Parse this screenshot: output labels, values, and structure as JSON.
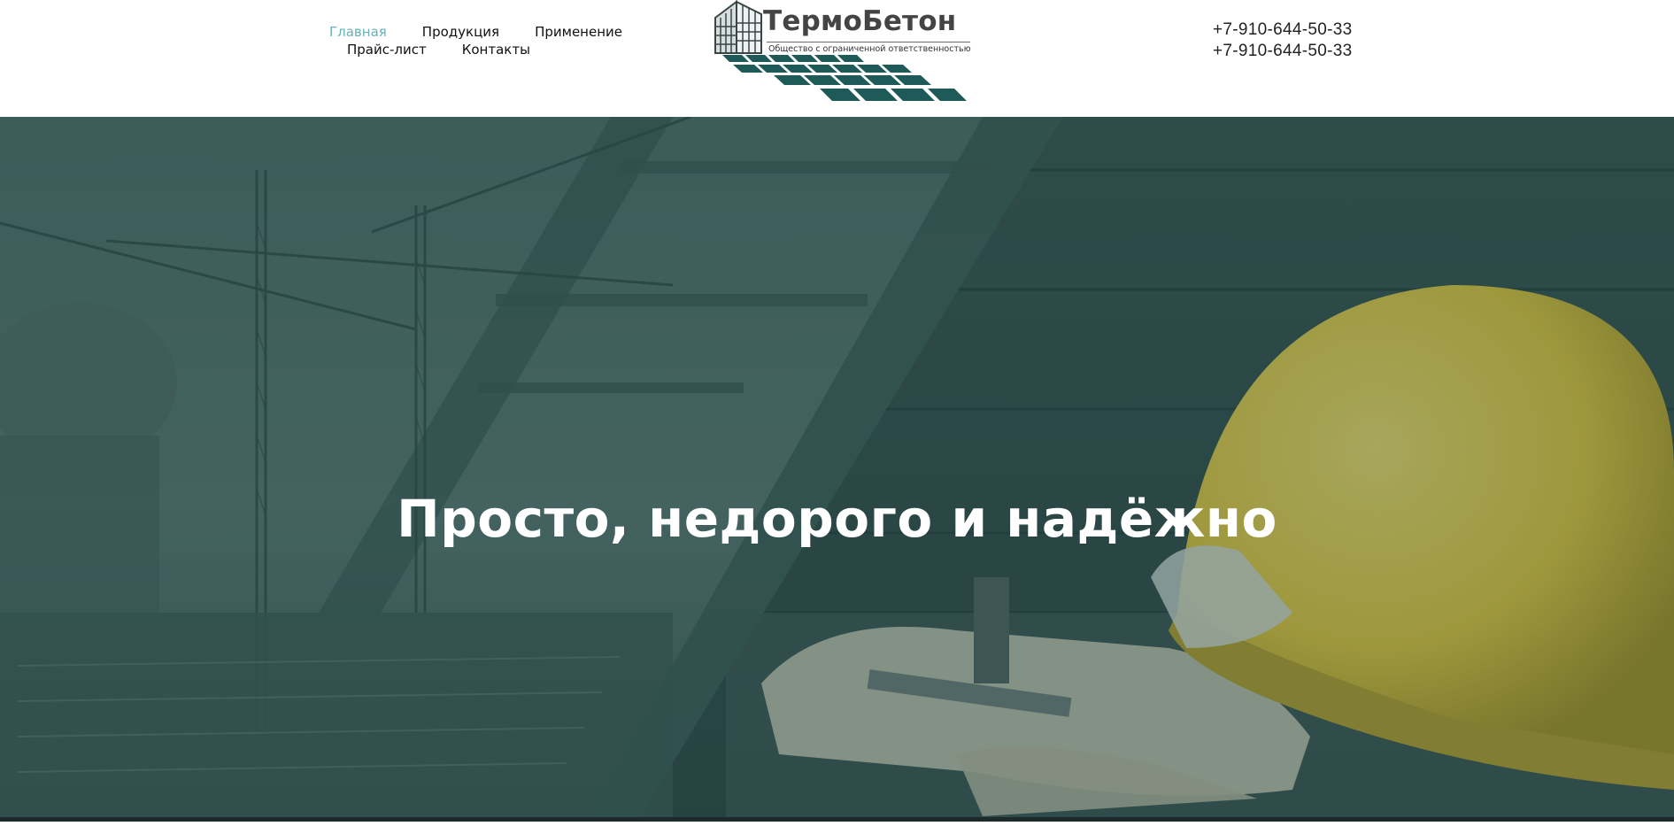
{
  "nav": {
    "items": [
      {
        "label": "Главная",
        "active": true
      },
      {
        "label": "Продукция",
        "active": false
      },
      {
        "label": "Применение",
        "active": false
      },
      {
        "label": "Прайс-лист",
        "active": false
      },
      {
        "label": "Контакты",
        "active": false
      }
    ]
  },
  "logo": {
    "brand": "ТермоБетон",
    "subtitle": "Общество с ограниченной ответственностью"
  },
  "phones": [
    "+7-910-644-50-33",
    "+7-910-644-50-33"
  ],
  "hero": {
    "title": "Просто, недорого и надёжно"
  },
  "colors": {
    "accent": "#6bb0b7",
    "hero_overlay": "#2a4c4b",
    "logo_tiles": "#1e5a57",
    "helmet": "#e2c43a"
  }
}
